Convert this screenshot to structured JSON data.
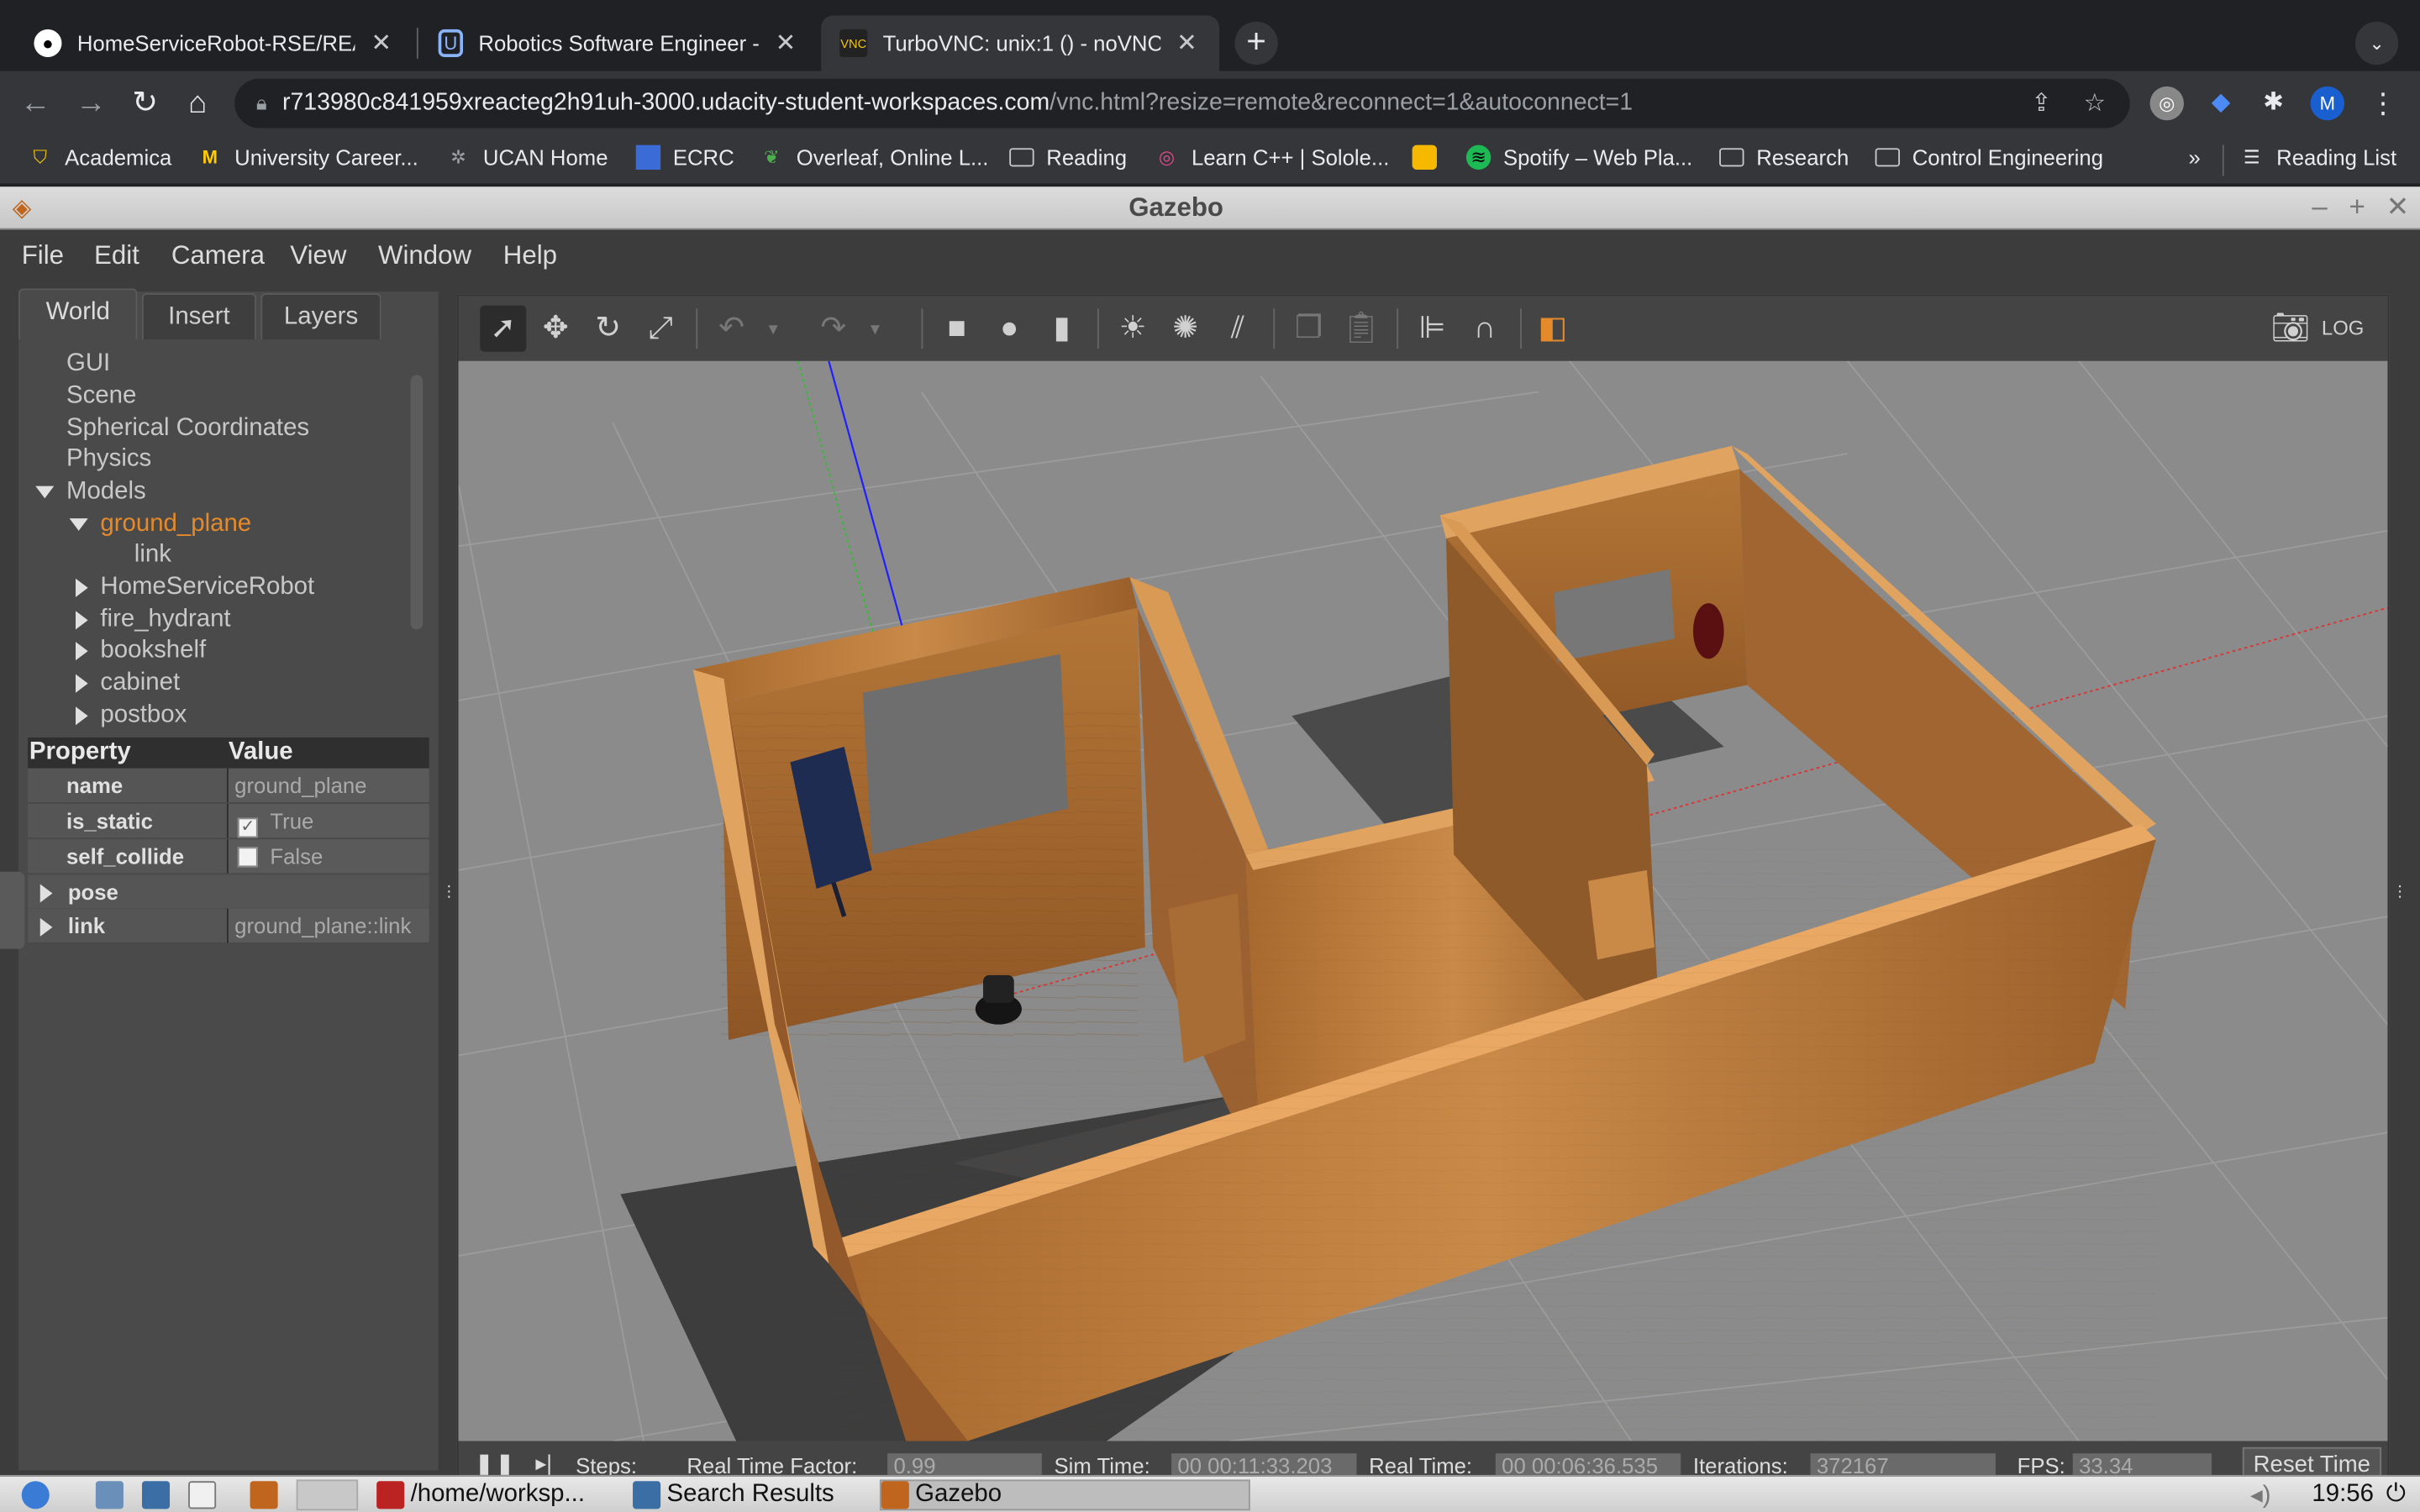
{
  "browser": {
    "tabs": [
      {
        "title": "HomeServiceRobot-RSE/READ",
        "icon": "github-icon"
      },
      {
        "title": "Robotics Software Engineer - U",
        "icon": "udacity-icon"
      },
      {
        "title": "TurboVNC: unix:1 () - noVNC",
        "icon": "vnc-icon",
        "active": true
      }
    ],
    "url_host": "r713980c841959xreacteg2h91uh-3000.udacity-student-workspaces.com",
    "url_path": "/vnc.html?resize=remote&reconnect=1&autoconnect=1",
    "profile_initial": "M",
    "bookmarks": [
      "Academica",
      "University Career...",
      "UCAN Home",
      "ECRC",
      "Overleaf, Online L...",
      "Reading",
      "Learn C++ | Sololе...",
      "",
      "Spotify – Web Pla...",
      "Research",
      "Control Engineering"
    ],
    "more_bookmarks": "»",
    "reading_list": "Reading List"
  },
  "gazebo": {
    "title": "Gazebo",
    "menu": [
      "File",
      "Edit",
      "Camera",
      "View",
      "Window",
      "Help"
    ],
    "left_tabs": [
      "World",
      "Insert",
      "Layers"
    ],
    "tree": {
      "gui": "GUI",
      "scene": "Scene",
      "spherical": "Spherical Coordinates",
      "physics": "Physics",
      "models": "Models",
      "ground_plane": "ground_plane",
      "link": "link",
      "items": [
        "HomeServiceRobot",
        "fire_hydrant",
        "bookshelf",
        "cabinet",
        "postbox"
      ]
    },
    "properties": {
      "header_property": "Property",
      "header_value": "Value",
      "rows": [
        {
          "key": "name",
          "value": "ground_plane"
        },
        {
          "key": "is_static",
          "value": "True"
        },
        {
          "key": "self_collide",
          "value": "False"
        },
        {
          "key": "pose",
          "value": ""
        },
        {
          "key": "link",
          "value": "ground_plane::link"
        }
      ]
    },
    "status": {
      "steps": "Steps:",
      "rtf_label": "Real Time Factor:",
      "rtf": "0.99",
      "sim_label": "Sim Time:",
      "sim": "00 00:11:33.203",
      "real_label": "Real Time:",
      "real": "00 00:06:36.535",
      "iter_label": "Iterations:",
      "iter": "372167",
      "fps_label": "FPS:",
      "fps": "33.34",
      "reset": "Reset Time"
    }
  },
  "taskbar": {
    "terminal": "/home/worksp...",
    "search": "Search Results",
    "gazebo": "Gazebo",
    "clock": "19:56"
  },
  "colors": {
    "accent_orange": "#e58a2b",
    "wood": "#b7793a"
  }
}
